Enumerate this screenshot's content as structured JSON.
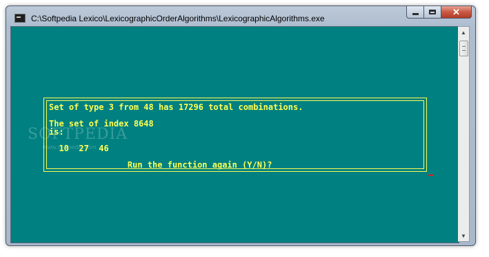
{
  "window": {
    "title": "C:\\Softpedia Lexico\\LexicographicOrderAlgorithms\\LexicographicAlgorithms.exe",
    "buttons": {
      "close_glyph": "✕"
    },
    "icon": "console-app-icon"
  },
  "console": {
    "background": "#008080",
    "text_color": "#ffff54",
    "lines": [
      "Set of type 3 from 48 has 17296 total combinations.",
      "The set of index 8648",
      "is:",
      "  10  27  46",
      "             Run the function again (Y/N)?"
    ]
  },
  "watermark": {
    "text": "SOFTPEDIA",
    "sub": "www.softpedia.com"
  },
  "scrollbar": {
    "up_glyph": "▲",
    "down_glyph": "▼"
  }
}
